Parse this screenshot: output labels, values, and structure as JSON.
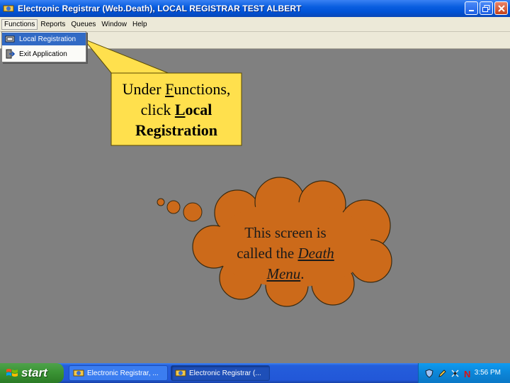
{
  "window": {
    "title": "Electronic Registrar (Web.Death), LOCAL REGISTRAR TEST   ALBERT",
    "app_icon": "registrar-app-icon",
    "controls": [
      "minimize-icon",
      "maximize-icon",
      "close-icon"
    ]
  },
  "menubar": {
    "items": [
      "Functions",
      "Reports",
      "Queues",
      "Window",
      "Help"
    ]
  },
  "dropdown": {
    "items": [
      {
        "label": "Local Registration",
        "icon": "registration-icon",
        "selected": true
      },
      {
        "label": "Exit Application",
        "icon": "exit-icon",
        "selected": false
      }
    ]
  },
  "callout": {
    "line1_a": "Under ",
    "line1_u": "F",
    "line1_b": "unctions,",
    "line2_a": "click ",
    "line2_u": "L",
    "line2_b": "ocal",
    "line3": "Registration",
    "fill": "#ffe04d"
  },
  "cloud": {
    "line1": "This screen is",
    "line2_a": "called the ",
    "line2_u": "Death",
    "line3_u": "Menu",
    "line3_b": ".",
    "fill": "#cc6a1a"
  },
  "taskbar": {
    "start_label": "start",
    "tasks": [
      "Electronic Registrar, ...",
      "Electronic Registrar (..."
    ],
    "tray_icons": [
      "shield-icon",
      "pencil-icon",
      "network-icon",
      "n-icon"
    ],
    "clock": "3:56 PM"
  }
}
